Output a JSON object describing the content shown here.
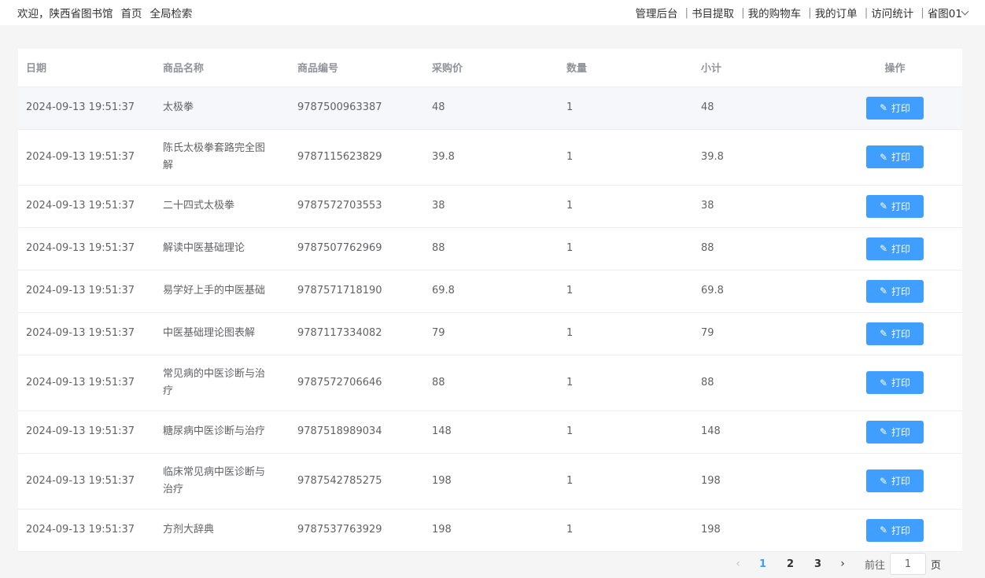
{
  "header": {
    "welcome": "欢迎，陕西省图书馆",
    "home": "首页",
    "global_search": "全局检索",
    "admin": "管理后台",
    "catalog": "书目提取",
    "cart": "我的购物车",
    "orders": "我的订单",
    "stats": "访问统计",
    "user": "省图01",
    "sep": "|"
  },
  "table": {
    "columns": [
      "日期",
      "商品名称",
      "商品编号",
      "采购价",
      "数量",
      "小计",
      "操作"
    ],
    "action_label": "打印",
    "rows": [
      {
        "date": "2024-09-13 19:51:37",
        "name": "太极拳",
        "code": "9787500963387",
        "price": "48",
        "qty": "1",
        "subtotal": "48"
      },
      {
        "date": "2024-09-13 19:51:37",
        "name": "陈氏太极拳套路完全图解",
        "code": "9787115623829",
        "price": "39.8",
        "qty": "1",
        "subtotal": "39.8"
      },
      {
        "date": "2024-09-13 19:51:37",
        "name": "二十四式太极拳",
        "code": "9787572703553",
        "price": "38",
        "qty": "1",
        "subtotal": "38"
      },
      {
        "date": "2024-09-13 19:51:37",
        "name": "解读中医基础理论",
        "code": "9787507762969",
        "price": "88",
        "qty": "1",
        "subtotal": "88"
      },
      {
        "date": "2024-09-13 19:51:37",
        "name": "易学好上手的中医基础",
        "code": "9787571718190",
        "price": "69.8",
        "qty": "1",
        "subtotal": "69.8"
      },
      {
        "date": "2024-09-13 19:51:37",
        "name": "中医基础理论图表解",
        "code": "9787117334082",
        "price": "79",
        "qty": "1",
        "subtotal": "79"
      },
      {
        "date": "2024-09-13 19:51:37",
        "name": "常见病的中医诊断与治疗",
        "code": "9787572706646",
        "price": "88",
        "qty": "1",
        "subtotal": "88"
      },
      {
        "date": "2024-09-13 19:51:37",
        "name": "糖尿病中医诊断与治疗",
        "code": "9787518989034",
        "price": "148",
        "qty": "1",
        "subtotal": "148"
      },
      {
        "date": "2024-09-13 19:51:37",
        "name": "临床常见病中医诊断与治疗",
        "code": "9787542785275",
        "price": "198",
        "qty": "1",
        "subtotal": "198"
      },
      {
        "date": "2024-09-13 19:51:37",
        "name": "方剂大辞典",
        "code": "9787537763929",
        "price": "198",
        "qty": "1",
        "subtotal": "198"
      }
    ]
  },
  "pagination": {
    "pages": [
      "1",
      "2",
      "3"
    ],
    "current": "1",
    "goto_prefix": "前往",
    "goto_value": "1",
    "goto_suffix": "页"
  },
  "colors": {
    "primary": "#409eff",
    "header_text": "#909399",
    "row_highlight": "#f5f7fa"
  },
  "icons": {
    "edit": "edit-icon",
    "prev": "chevron-left-icon",
    "next": "chevron-right-icon",
    "dropdown": "chevron-down-icon"
  }
}
